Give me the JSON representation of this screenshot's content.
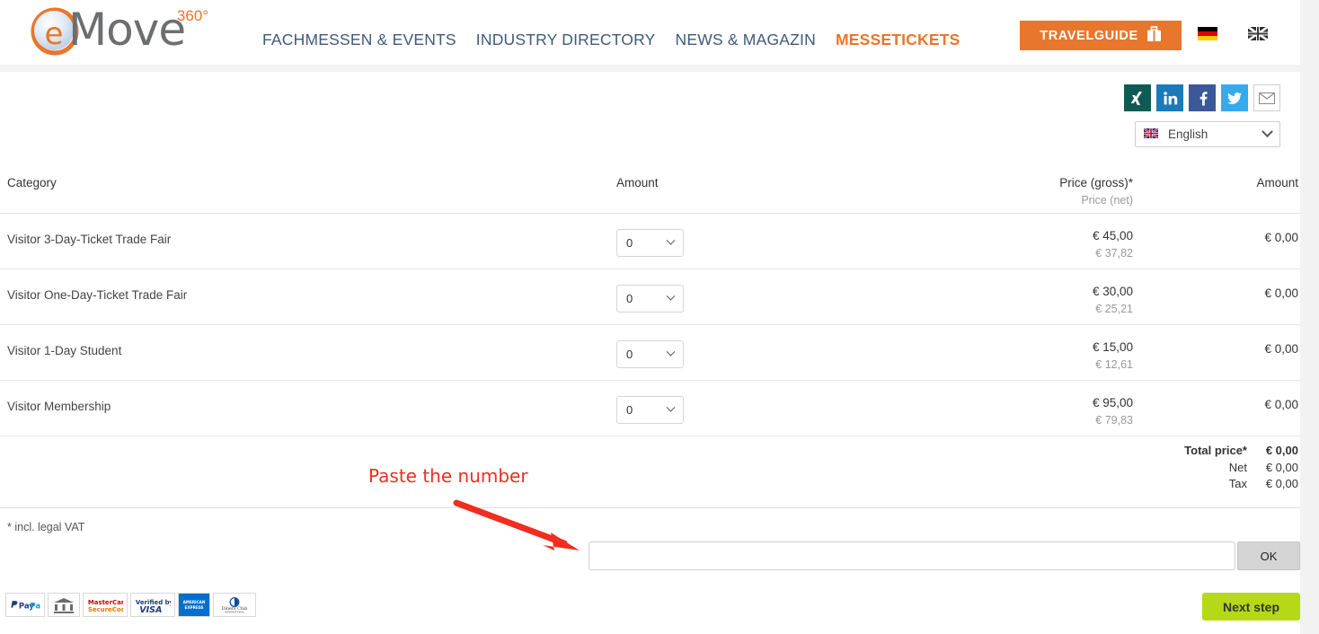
{
  "header": {
    "logo": {
      "word": "Move",
      "sup": "360°",
      "letter": "e",
      "icon": "emove-logo-icon"
    },
    "nav": [
      {
        "label": "FACHMESSEN & EVENTS",
        "active": false
      },
      {
        "label": "INDUSTRY DIRECTORY",
        "active": false
      },
      {
        "label": "NEWS & MAGAZIN",
        "active": false
      },
      {
        "label": "MESSETICKETS",
        "active": true
      }
    ],
    "travelguide_label": "TRAVELGUIDE",
    "travelguide_icon": "suitcase-icon",
    "flags": [
      {
        "name": "flag-de-icon",
        "title": "Deutsch"
      },
      {
        "name": "flag-uk-icon",
        "title": "English"
      }
    ]
  },
  "social": [
    {
      "name": "xing-icon",
      "glyph": "X"
    },
    {
      "name": "linkedin-icon",
      "glyph": "in"
    },
    {
      "name": "facebook-icon",
      "glyph": "f"
    },
    {
      "name": "twitter-icon",
      "glyph": "ᵠ"
    },
    {
      "name": "email-icon",
      "glyph": "✉"
    }
  ],
  "language": {
    "selected": "English",
    "flag": "flag-uk-icon"
  },
  "table": {
    "headers": {
      "category": "Category",
      "amount": "Amount",
      "price_gross": "Price (gross)*",
      "price_net": "Price (net)",
      "total": "Amount"
    },
    "rows": [
      {
        "category": "Visitor 3-Day-Ticket Trade Fair",
        "qty": "0",
        "price_gross": "€ 45,00",
        "price_net": "€ 37,82",
        "amount": "€ 0,00"
      },
      {
        "category": "Visitor One-Day-Ticket Trade Fair",
        "qty": "0",
        "price_gross": "€ 30,00",
        "price_net": "€ 25,21",
        "amount": "€ 0,00"
      },
      {
        "category": "Visitor 1-Day Student",
        "qty": "0",
        "price_gross": "€ 15,00",
        "price_net": "€ 12,61",
        "amount": "€ 0,00"
      },
      {
        "category": "Visitor Membership",
        "qty": "0",
        "price_gross": "€ 95,00",
        "price_net": "€ 79,83",
        "amount": "€ 0,00"
      }
    ]
  },
  "totals": {
    "total_price_label": "Total price*",
    "total_price_value": "€ 0,00",
    "net_label": "Net",
    "net_value": "€ 0,00",
    "tax_label": "Tax",
    "tax_value": "€ 0,00"
  },
  "vat_note": "* incl. legal VAT",
  "voucher": {
    "value": "",
    "placeholder": "",
    "ok_label": "OK"
  },
  "annotation": {
    "text": "Paste the number",
    "color": "#ef2d20",
    "arrow": "red-arrow-icon"
  },
  "payment_logos": [
    {
      "name": "paypal-logo",
      "label": "PayPal"
    },
    {
      "name": "bank-transfer-logo",
      "label": ""
    },
    {
      "name": "mastercard-securecode-logo",
      "label": "MasterCard SecureCode"
    },
    {
      "name": "verified-by-visa-logo",
      "label": "Verified by VISA"
    },
    {
      "name": "american-express-logo",
      "label": "AMERICAN EXPRESS"
    },
    {
      "name": "diners-club-logo",
      "label": "Diners Club INTERNATIONAL"
    }
  ],
  "next_button": {
    "label": "Next step",
    "color": "#b5d916"
  }
}
